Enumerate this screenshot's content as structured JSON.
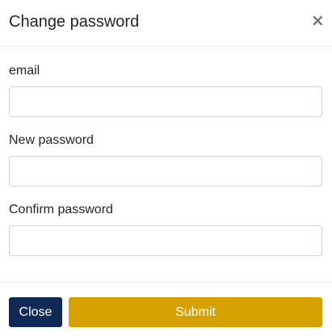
{
  "modal": {
    "title": "Change password",
    "close_icon": "×"
  },
  "form": {
    "fields": [
      {
        "label": "email",
        "value": "",
        "placeholder": ""
      },
      {
        "label": "New password",
        "value": "",
        "placeholder": ""
      },
      {
        "label": "Confirm password",
        "value": "",
        "placeholder": ""
      }
    ]
  },
  "footer": {
    "close_label": "Close",
    "submit_label": "Submit"
  },
  "colors": {
    "close_button": "#0f2a57",
    "submit_button": "#d6a100"
  }
}
